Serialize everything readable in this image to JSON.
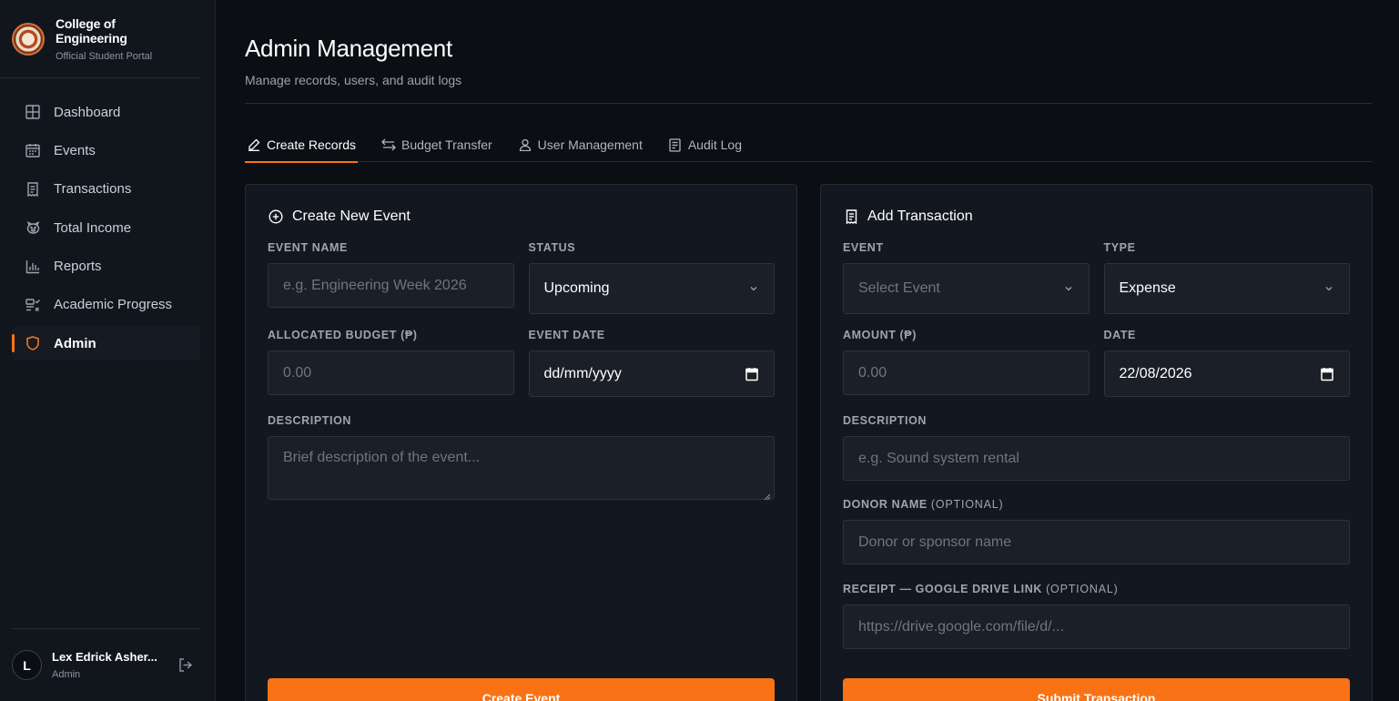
{
  "brand": {
    "title": "College of Engineering",
    "subtitle": "Official Student Portal"
  },
  "sidebar": {
    "items": [
      {
        "label": "Dashboard",
        "icon": "grid-icon"
      },
      {
        "label": "Events",
        "icon": "calendar-icon"
      },
      {
        "label": "Transactions",
        "icon": "receipt-icon"
      },
      {
        "label": "Total Income",
        "icon": "piggy-bank-icon"
      },
      {
        "label": "Reports",
        "icon": "bar-chart-icon"
      },
      {
        "label": "Academic Progress",
        "icon": "list-check-icon"
      },
      {
        "label": "Admin",
        "icon": "shield-icon",
        "active": true
      }
    ]
  },
  "user": {
    "initial": "L",
    "name": "Lex Edrick Asher...",
    "role": "Admin"
  },
  "page": {
    "title": "Admin Management",
    "subtitle": "Manage records, users, and audit logs"
  },
  "tabs": [
    {
      "label": "Create Records",
      "icon": "pencil-icon",
      "active": true
    },
    {
      "label": "Budget Transfer",
      "icon": "transfer-icon"
    },
    {
      "label": "User Management",
      "icon": "user-icon"
    },
    {
      "label": "Audit Log",
      "icon": "document-icon"
    }
  ],
  "event_form": {
    "title": "Create New Event",
    "name_label": "EVENT NAME",
    "name_placeholder": "e.g. Engineering Week 2026",
    "status_label": "STATUS",
    "status_value": "Upcoming",
    "budget_label": "ALLOCATED BUDGET (₱)",
    "budget_placeholder": "0.00",
    "date_label": "EVENT DATE",
    "date_value": "dd/mm/yyyy",
    "description_label": "DESCRIPTION",
    "description_placeholder": "Brief description of the event...",
    "submit_label": "Create Event"
  },
  "transaction_form": {
    "title": "Add Transaction",
    "event_label": "EVENT",
    "event_placeholder": "Select Event",
    "type_label": "TYPE",
    "type_value": "Expense",
    "amount_label": "AMOUNT (₱)",
    "amount_placeholder": "0.00",
    "date_label": "DATE",
    "date_value": "22/08/2026",
    "description_label": "DESCRIPTION",
    "description_placeholder": "e.g. Sound system rental",
    "donor_label": "DONOR NAME",
    "donor_optional": "(OPTIONAL)",
    "donor_placeholder": "Donor or sponsor name",
    "receipt_label": "RECEIPT — GOOGLE DRIVE LINK",
    "receipt_optional": "(OPTIONAL)",
    "receipt_placeholder": "https://drive.google.com/file/d/...",
    "submit_label": "Submit Transaction"
  },
  "colors": {
    "accent": "#f97316",
    "background": "#0b0e13",
    "sidebar": "#11161d",
    "card": "#131820"
  }
}
